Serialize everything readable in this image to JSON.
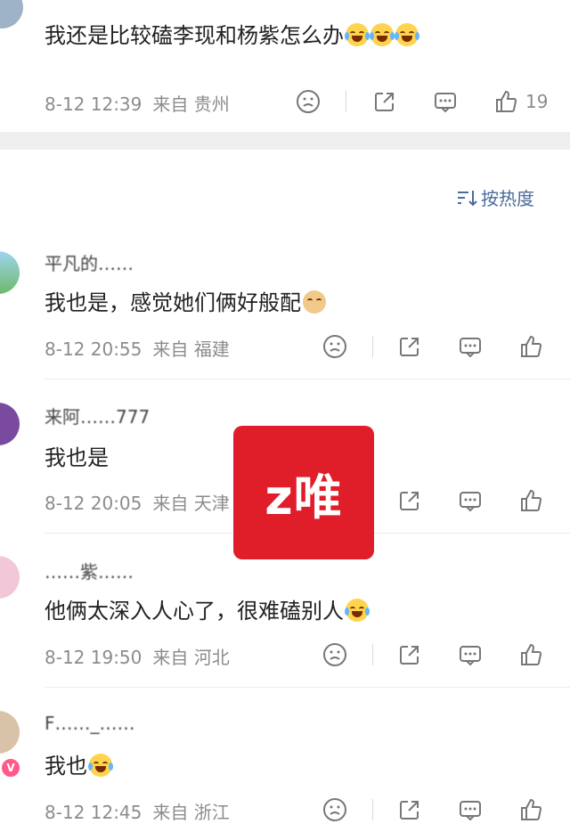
{
  "top_comment": {
    "content": "我还是比较磕李现和杨紫怎么办",
    "time": "8-12 12:39",
    "location": "来自 贵州",
    "likes": "19"
  },
  "sort": {
    "label": "按热度"
  },
  "comments": [
    {
      "name": "平凡的……",
      "content": "我也是，感觉她们俩好般配",
      "time": "8-12 20:55",
      "location": "来自 福建",
      "likes": ""
    },
    {
      "name": "来阿……777",
      "content": "我也是",
      "time": "8-12 20:05",
      "location": "来自 天津",
      "likes": ""
    },
    {
      "name": "……紫……",
      "content": "他俩太深入人心了，很难磕别人",
      "time": "8-12 19:50",
      "location": "来自 河北",
      "likes": ""
    },
    {
      "name": "F……_……",
      "content": "我也",
      "time": "8-12 12:45",
      "location": "来自 浙江",
      "likes": ""
    }
  ],
  "watermark": {
    "text": "z唯",
    "color": "#e01e2a"
  },
  "icons": [
    "frown-icon",
    "share-icon",
    "comment-icon",
    "thumbs-up-icon",
    "sort-icon"
  ],
  "colors": {
    "meta": "#8c8c8c",
    "sort": "#4a6b9c",
    "divider_band": "#efefef"
  }
}
